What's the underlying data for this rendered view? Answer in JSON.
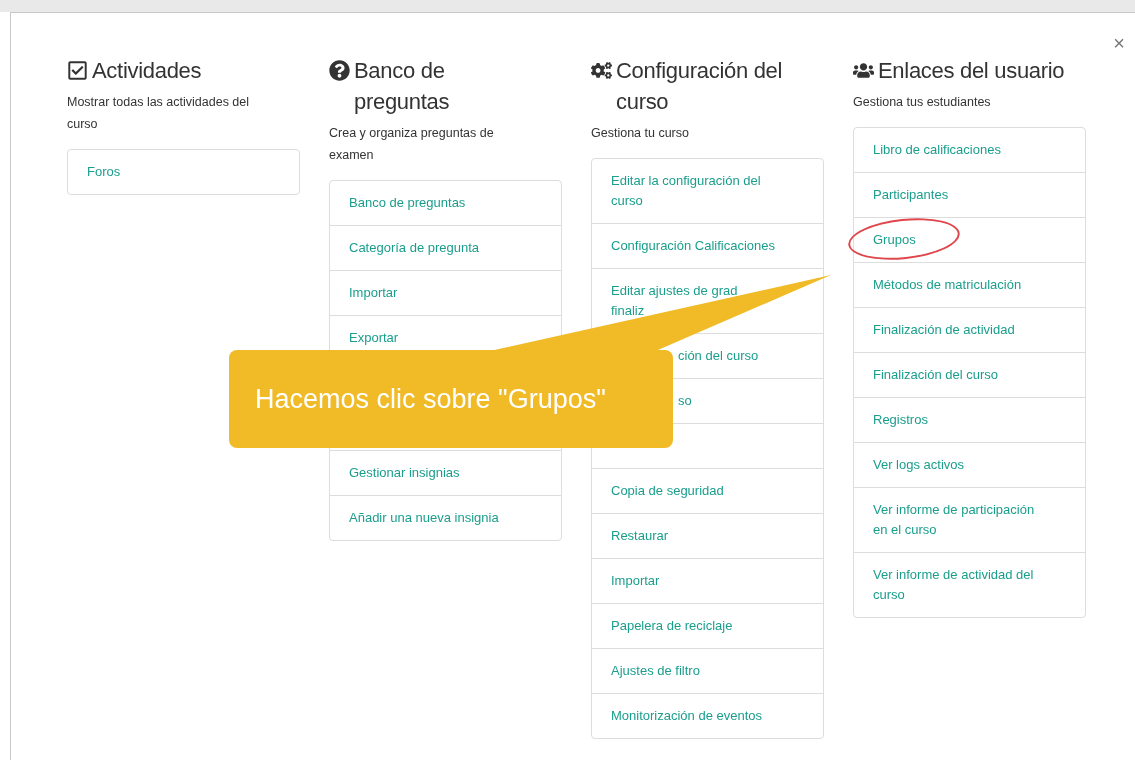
{
  "close_button": {
    "label": "×"
  },
  "columns": [
    {
      "title": "Actividades",
      "subtitle": "Mostrar todas las actividades del curso",
      "items": [
        {
          "kind": "link",
          "text": "Foros"
        }
      ]
    },
    {
      "title": "Banco de preguntas",
      "subtitle": "Crea y organiza preguntas de examen",
      "items": [
        {
          "kind": "link",
          "text": "Banco de preguntas"
        },
        {
          "kind": "link",
          "text": "Categoría de pregunta"
        },
        {
          "kind": "link",
          "text": "Importar"
        },
        {
          "kind": "link",
          "text": "Exportar"
        },
        {
          "kind": "covered"
        },
        {
          "kind": "covered"
        },
        {
          "kind": "link",
          "text": "Gestionar insignias"
        },
        {
          "kind": "link",
          "text": "Añadir una nueva insignia"
        }
      ]
    },
    {
      "title": "Configuración del curso",
      "subtitle": "Gestiona tu curso",
      "items": [
        {
          "kind": "link",
          "text": "Editar la configuración del curso"
        },
        {
          "kind": "link",
          "text": "Configuración Calificaciones"
        },
        {
          "kind": "link",
          "text": "Editar ajustes de grad",
          "second_line": "finaliz"
        },
        {
          "kind": "fragment",
          "text": "ción del curso"
        },
        {
          "kind": "fragment",
          "text": "so"
        },
        {
          "kind": "covered"
        },
        {
          "kind": "link",
          "text": "Copia de seguridad"
        },
        {
          "kind": "link",
          "text": "Restaurar"
        },
        {
          "kind": "link",
          "text": "Importar"
        },
        {
          "kind": "link",
          "text": "Papelera de reciclaje"
        },
        {
          "kind": "link",
          "text": "Ajustes de filtro"
        },
        {
          "kind": "link",
          "text": "Monitorización de eventos"
        }
      ]
    },
    {
      "title": "Enlaces del usuario",
      "subtitle": "Gestiona tus estudiantes",
      "items": [
        {
          "kind": "link",
          "text": "Libro de calificaciones",
          "highlighted": false
        },
        {
          "kind": "link",
          "text": "Participantes",
          "highlighted": false
        },
        {
          "kind": "link",
          "text": "Grupos",
          "highlighted": true
        },
        {
          "kind": "link",
          "text": "Métodos de matriculación",
          "highlighted": false
        },
        {
          "kind": "link",
          "text": "Finalización de actividad",
          "highlighted": false
        },
        {
          "kind": "link",
          "text": "Finalización del curso",
          "highlighted": false
        },
        {
          "kind": "link",
          "text": "Registros",
          "highlighted": false
        },
        {
          "kind": "link",
          "text": "Ver logs activos",
          "highlighted": false
        },
        {
          "kind": "link",
          "text": "Ver informe de participación en el curso",
          "highlighted": false
        },
        {
          "kind": "link",
          "text": "Ver informe de actividad del curso",
          "highlighted": false
        }
      ]
    }
  ],
  "callout": {
    "text": "Hacemos clic sobre \"Grupos\""
  }
}
